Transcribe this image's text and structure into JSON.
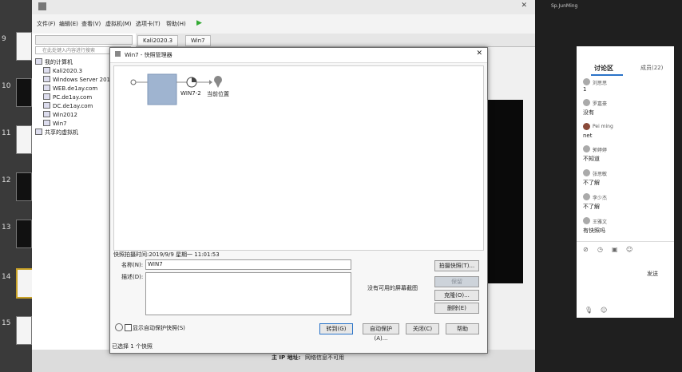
{
  "slides": {
    "numbers": [
      "9",
      "10",
      "11",
      "12",
      "13",
      "14",
      "15"
    ]
  },
  "vmware": {
    "menu": [
      "文件(F)",
      "编辑(E)",
      "查看(V)",
      "虚拟机(M)",
      "选项卡(T)",
      "帮助(H)"
    ],
    "library": {
      "search_placeholder": "在此处键入内容进行搜索",
      "root": "我的计算机",
      "vms": [
        "Kali2020.3",
        "Windows Server 201",
        "WEB.de1ay.com",
        "PC.de1ay.com",
        "DC.de1ay.com",
        "Win2012",
        "Win7"
      ],
      "shared": "共享的虚拟机"
    },
    "tabs": [
      "Kali2020.3",
      "Win7"
    ]
  },
  "dialog": {
    "title": "Win7 - 快照管理器",
    "tree": {
      "snapshot_label": "WIN7-2",
      "current_label": "当前位置"
    },
    "snapshot_time": "快照拍摄时间:2019/9/9 星期一 11:01:53",
    "name_label": "名称(N):",
    "name_value": "WIN7",
    "desc_label": "描述(D):",
    "no_screenshot": "没有可用的屏幕截图",
    "buttons": {
      "take_snapshot": "拍摄快照(T)...",
      "keep": "保留",
      "clone": "克隆(O)...",
      "delete": "删除(E)",
      "goto": "转到(G)",
      "autoprotect": "自动保护(A)...",
      "close": "关闭(C)",
      "help": "帮助"
    },
    "show_autoprotect": "显示自动保护快照(S)",
    "status": "已选择 1 个快照"
  },
  "bottom": {
    "ip_label": "主 IP 地址:",
    "ip_value": "网络信息不可用"
  },
  "right": {
    "title": "Sp.JunMing",
    "chat_header": "讨论区",
    "members": "成员(22)",
    "messages": [
      {
        "name": "刘思思",
        "text": "1"
      },
      {
        "name": "罗嘉豪",
        "text": "没有"
      },
      {
        "name": "Pei ming",
        "text": "net"
      },
      {
        "name": "郭婷婷",
        "text": "不知道"
      },
      {
        "name": "张思敏",
        "text": "不了解"
      },
      {
        "name": "李少杰",
        "text": "不了解"
      },
      {
        "name": "王雅文",
        "text": "有快照吗"
      }
    ],
    "footer": "发送"
  },
  "colors": {
    "accent": "#2a73c8",
    "selection": "#9fb4d0",
    "chat_bg": "#ffffff"
  }
}
